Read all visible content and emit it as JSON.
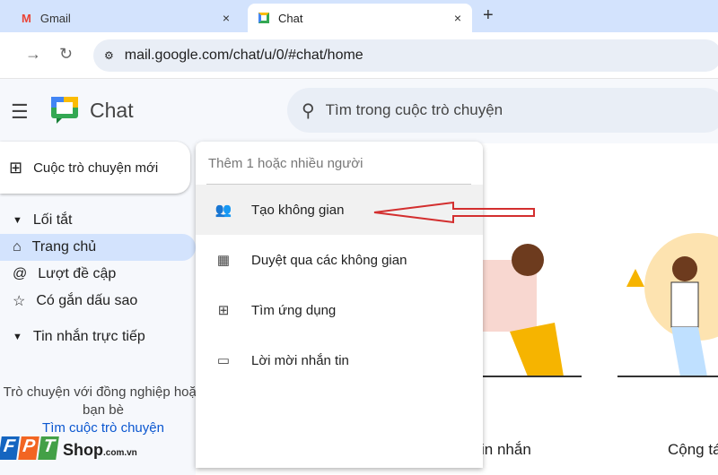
{
  "browser": {
    "tabs": [
      {
        "label": "Gmail",
        "close": "×"
      },
      {
        "label": "Chat",
        "close": "×"
      }
    ],
    "new_tab": "+",
    "url": "mail.google.com/chat/u/0/#chat/home"
  },
  "app": {
    "title": "Chat",
    "search_placeholder": "Tìm trong cuộc trò chuyện",
    "new_chat": "Cuộc trò chuyện mới"
  },
  "sidebar": {
    "shortcuts": "Lối tắt",
    "items": [
      {
        "label": "Trang chủ"
      },
      {
        "label": "Lượt đề cập"
      },
      {
        "label": "Có gắn dấu sao"
      }
    ],
    "direct": "Tin nhắn trực tiếp",
    "empty_text": "Trò chuyện với đồng nghiệp hoặc bạn bè",
    "empty_link": "Tìm cuộc trò chuyện"
  },
  "menu": {
    "placeholder": "Thêm 1 hoặc nhiều người",
    "items": [
      {
        "label": "Tạo không gian"
      },
      {
        "label": "Duyệt qua các không gian"
      },
      {
        "label": "Tìm ứng dụng"
      },
      {
        "label": "Lời mời nhắn tin"
      }
    ]
  },
  "main": {
    "caption1": "in nhắn",
    "caption2": "Cộng tá"
  },
  "watermark": {
    "brand": "FPT",
    "shop": "Shop",
    "domain": ".com.vn"
  },
  "colors": {
    "accent": "#0b57d0",
    "arrow": "#d32f2f"
  }
}
